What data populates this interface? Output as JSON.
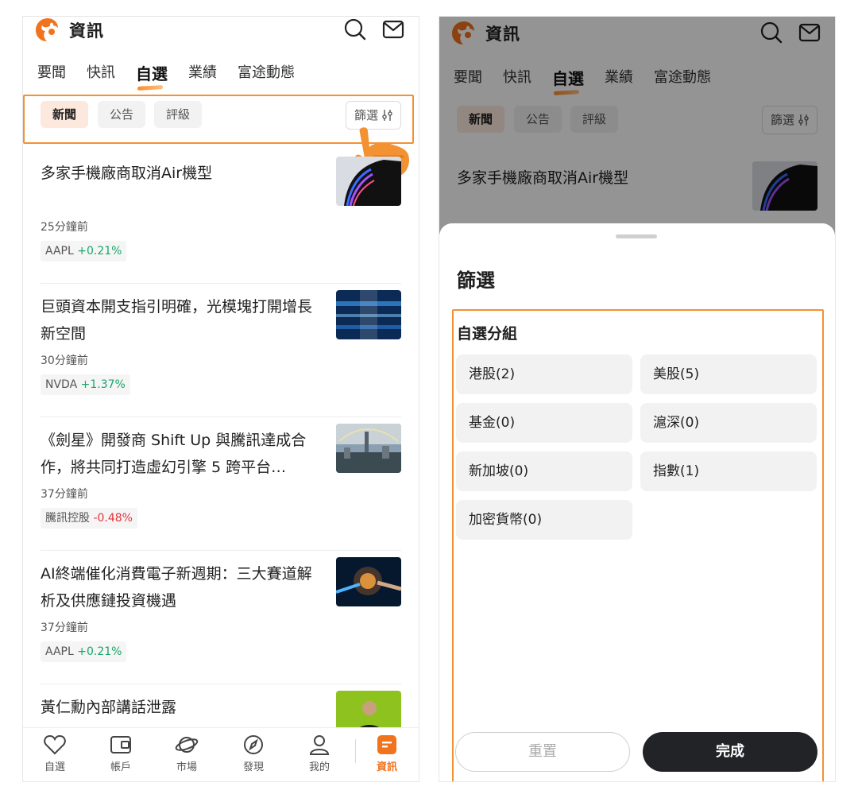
{
  "app": {
    "title": "資訊"
  },
  "tabs": [
    "要聞",
    "快訊",
    "自選",
    "業績",
    "富途動態"
  ],
  "filter_chips": [
    "新聞",
    "公告",
    "評級"
  ],
  "filter_button": "篩選",
  "news": [
    {
      "title": "多家手機廠商取消Air機型",
      "time": "25分鐘前",
      "stock": "AAPL",
      "change": "+0.21%"
    },
    {
      "title": "巨頭資本開支指引明確，光模塊打開增長新空間",
      "time": "30分鐘前",
      "stock": "NVDA",
      "change": "+1.37%"
    },
    {
      "title": "《劍星》開發商 Shift Up 與騰訊達成合作，將共同打造虛幻引擎 5 跨平台…",
      "time": "37分鐘前",
      "stock": "騰訊控股",
      "change": "-0.48%"
    },
    {
      "title": "AI終端催化消費電子新週期：三大賽道解析及供應鏈投資機遇",
      "time": "37分鐘前",
      "stock": "AAPL",
      "change": "+0.21%"
    },
    {
      "title": "黃仁勳內部講話泄露",
      "time": "",
      "stock": "",
      "change": ""
    }
  ],
  "bottom_nav": [
    "自選",
    "帳戶",
    "市場",
    "發現",
    "我的",
    "資訊"
  ],
  "sheet": {
    "title": "篩選",
    "group_title": "自選分組",
    "groups": [
      "港股(2)",
      "美股(5)",
      "基金(0)",
      "滬深(0)",
      "新加坡(0)",
      "指數(1)",
      "加密貨幣(0)"
    ],
    "reset": "重置",
    "done": "完成"
  },
  "colors": {
    "accent": "#f2731d",
    "highlight": "#f39233",
    "up": "#17a76a",
    "down": "#e5323e"
  }
}
